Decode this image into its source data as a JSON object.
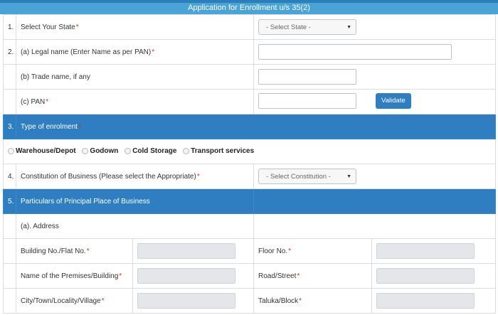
{
  "header": {
    "title": "Application for Enrollment u/s 35(2)"
  },
  "rows": {
    "state": {
      "num": "1.",
      "label": "Select Your State",
      "placeholder": "- Select State -"
    },
    "legal_name": {
      "num": "2.",
      "label": "(a) Legal name (Enter Name as per PAN)"
    },
    "trade_name": {
      "label": "(b) Trade name, if any"
    },
    "pan": {
      "label": "(c) PAN",
      "button": "Validate"
    },
    "enrolment": {
      "num": "3.",
      "label": "Type of enrolment",
      "options": [
        "Warehouse/Depot",
        "Godown",
        "Cold Storage",
        "Transport services"
      ]
    },
    "constitution": {
      "num": "4.",
      "label": "Constitution of Business (Please select the Appropriate)",
      "placeholder": "- Select Constitution -"
    },
    "principal": {
      "num": "5.",
      "label": "Particulars of Principal Place of Business"
    },
    "address": {
      "label": "(a). Address",
      "building": "Building No./Flat No.",
      "floor": "Floor No.",
      "premises": "Name of the Premises/Building",
      "road": "Road/Street",
      "city": "City/Town/Locality/Village",
      "taluka": "Taluka/Block"
    }
  },
  "required_mark": "*"
}
